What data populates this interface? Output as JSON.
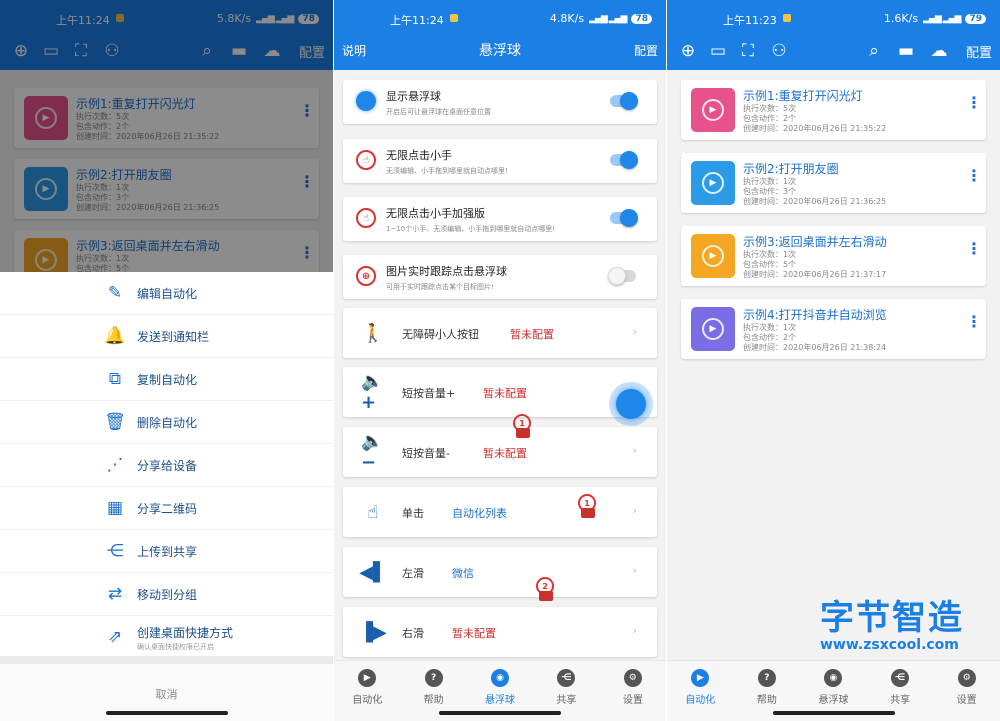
{
  "colors": {
    "primary": "#1c7fe6",
    "accent_red": "#c9302c",
    "link": "#1b6fd0"
  },
  "panel1": {
    "status": {
      "time": "上午11:24",
      "speed": "5.8K/s",
      "battery": "78"
    },
    "toolbar": {
      "icons": [
        "add-circle-icon",
        "record-icon",
        "scan-icon",
        "network-icon",
        "search-icon",
        "folder-icon",
        "upload-icon"
      ],
      "config": "配置"
    },
    "list": [
      {
        "title": "示例1:重复打开闪光灯",
        "runs": "执行次数：5次",
        "actions": "包含动作：2个",
        "created": "创建时间：2020年06月26日 21:35:22",
        "color": "#e8528a"
      },
      {
        "title": "示例2:打开朋友圈",
        "runs": "执行次数：1次",
        "actions": "包含动作：3个",
        "created": "创建时间：2020年06月26日 21:36:25",
        "color": "#2b9be8"
      },
      {
        "title": "示例3:返回桌面并左右滑动",
        "runs": "执行次数：1次",
        "actions": "包含动作：5个",
        "created": "",
        "color": "#f5a623"
      }
    ],
    "sheet": [
      {
        "label": "编辑自动化",
        "icon": "edit-icon",
        "glyph": "✎"
      },
      {
        "label": "发送到通知栏",
        "icon": "bell-icon",
        "glyph": "🔔"
      },
      {
        "label": "复制自动化",
        "icon": "copy-icon",
        "glyph": "⧉"
      },
      {
        "label": "删除自动化",
        "icon": "trash-icon",
        "glyph": "🗑"
      },
      {
        "label": "分享给设备",
        "icon": "share-device-icon",
        "glyph": "⋰"
      },
      {
        "label": "分享二维码",
        "icon": "qrcode-icon",
        "glyph": "▦"
      },
      {
        "label": "上传到共享",
        "icon": "upload-share-icon",
        "glyph": "⋲"
      },
      {
        "label": "移动到分组",
        "icon": "move-icon",
        "glyph": "⇄"
      },
      {
        "label": "创建桌面快捷方式",
        "sub": "确认桌面快捷权限已开启",
        "icon": "shortcut-icon",
        "glyph": "⇗"
      }
    ],
    "cancel": "取消"
  },
  "panel2": {
    "status": {
      "time": "上午11:24",
      "speed": "4.8K/s",
      "battery": "78"
    },
    "header": {
      "left": "说明",
      "title": "悬浮球",
      "right": "配置"
    },
    "options": [
      {
        "title": "显示悬浮球",
        "desc": "开启后可让悬浮球在桌面任意位置",
        "on": true,
        "icon": "ball-icon"
      },
      {
        "title": "无限点击小手",
        "desc": "无须编辑、小手拖到哪里就自动点哪里!",
        "on": true,
        "icon": "hand-tap-icon"
      },
      {
        "title": "无限点击小手加强版",
        "desc": "1~10个小手、无须编辑、小手拖到哪里就自动点哪里!",
        "on": true,
        "icon": "hand-tap-plus-icon"
      },
      {
        "title": "图片实时跟踪点击悬浮球",
        "desc": "可用于实时跟踪点击某个目标图片!",
        "on": false,
        "icon": "target-icon"
      }
    ],
    "rows": [
      {
        "label": "无障碍小人按钮",
        "value": "暂未配置",
        "value_color": "red",
        "icon": "accessibility-icon",
        "glyph": "🚶"
      },
      {
        "label": "短按音量+",
        "value": "暂未配置",
        "value_color": "red",
        "icon": "volume-up-icon",
        "glyph": "🔈+"
      },
      {
        "label": "短按音量-",
        "value": "暂未配置",
        "value_color": "red",
        "icon": "volume-down-icon",
        "glyph": "🔈−"
      },
      {
        "label": "单击",
        "value": "自动化列表",
        "value_color": "blue",
        "icon": "single-tap-icon",
        "glyph": "☝"
      },
      {
        "label": "左滑",
        "value": "微信",
        "value_color": "blue",
        "icon": "swipe-left-icon",
        "glyph": "◀▌"
      },
      {
        "label": "右滑",
        "value": "暂未配置",
        "value_color": "red",
        "icon": "swipe-right-icon",
        "glyph": "▐▶"
      }
    ],
    "tap_markers": [
      "1",
      "1",
      "2"
    ],
    "nav": [
      "自动化",
      "帮助",
      "悬浮球",
      "共享",
      "设置"
    ],
    "nav_active": 2
  },
  "panel3": {
    "status": {
      "time": "上午11:23",
      "speed": "1.6K/s",
      "battery": "79"
    },
    "toolbar": {
      "icons": [
        "add-circle-icon",
        "record-icon",
        "scan-icon",
        "network-icon",
        "search-icon",
        "folder-icon",
        "upload-icon"
      ],
      "config": "配置"
    },
    "list": [
      {
        "title": "示例1:重复打开闪光灯",
        "runs": "执行次数：5次",
        "actions": "包含动作：2个",
        "created": "创建时间：2020年06月26日 21:35:22",
        "color": "#e8528a"
      },
      {
        "title": "示例2:打开朋友圈",
        "runs": "执行次数：1次",
        "actions": "包含动作：3个",
        "created": "创建时间：2020年06月26日 21:36:25",
        "color": "#2b9be8"
      },
      {
        "title": "示例3:返回桌面并左右滑动",
        "runs": "执行次数：1次",
        "actions": "包含动作：5个",
        "created": "创建时间：2020年06月26日 21:37:17",
        "color": "#f5a623"
      },
      {
        "title": "示例4:打开抖音并自动浏览",
        "runs": "执行次数：1次",
        "actions": "包含动作：2个",
        "created": "创建时间：2020年06月26日 21:38:24",
        "color": "#7b6de6"
      }
    ],
    "nav": [
      "自动化",
      "帮助",
      "悬浮球",
      "共享",
      "设置"
    ],
    "nav_active": 0
  },
  "watermark": {
    "title": "字节智造",
    "url": "www.zsxcool.com"
  }
}
